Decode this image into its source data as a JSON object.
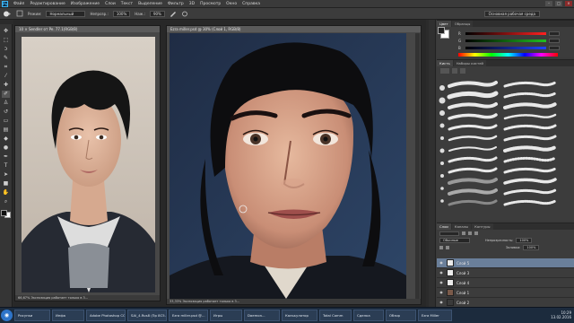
{
  "menubar": {
    "logo": "Ps",
    "items": [
      "Файл",
      "Редактирование",
      "Изображение",
      "Слои",
      "Текст",
      "Выделение",
      "Фильтр",
      "3D",
      "Просмотр",
      "Окно",
      "Справка"
    ],
    "window_buttons": [
      "–",
      "□",
      "×"
    ]
  },
  "options": {
    "mode_label": "Режим:",
    "mode_value": "Нормальный",
    "opacity_label": "Непрозр.:",
    "opacity_value": "100%",
    "flow_label": "Наж.:",
    "flow_value": "90%",
    "workspace": "Основная рабочая среда"
  },
  "tools": {
    "icons": [
      "move",
      "marquee",
      "lasso",
      "quick-select",
      "crop",
      "eyedropper",
      "healing",
      "brush",
      "stamp",
      "history-brush",
      "eraser",
      "gradient",
      "blur",
      "dodge",
      "pen",
      "type",
      "path-select",
      "shape",
      "hand",
      "zoom"
    ]
  },
  "doc1": {
    "title": "10 × Sendler от Pe. 77.1(RGB/8)",
    "status": "66,67%   Экспозиция работает только в 3..."
  },
  "doc2": {
    "title": "Ezra miller.psd @ 30% (Слой 1, RGB/8)",
    "status": "33,33%   Экспозиция работает только в 3..."
  },
  "color_panel": {
    "tabs": [
      "Цвет",
      "Образцы"
    ],
    "slider_labels": [
      "R",
      "G",
      "B"
    ],
    "slider_values": [
      "",
      "",
      ""
    ],
    "colors": {
      "r_track": "#ff2020",
      "g_track": "#20c020",
      "b_track": "#2040ff"
    }
  },
  "brush_panel": {
    "tabs": [
      "Кисть",
      "Наборы кистей"
    ]
  },
  "layers_panel": {
    "tabs": [
      "Слои",
      "Каналы",
      "Контуры"
    ],
    "blend_mode": "Обычные",
    "opacity_label": "Непрозрачность:",
    "opacity_value": "100%",
    "fill_label": "Заливка:",
    "fill_value": "100%",
    "layers": [
      {
        "name": "Слой 5",
        "visible": true,
        "selected": true
      },
      {
        "name": "Слой 3",
        "visible": true,
        "selected": false
      },
      {
        "name": "Слой 4",
        "visible": true,
        "selected": false
      },
      {
        "name": "Слой 1",
        "visible": true,
        "selected": false
      },
      {
        "name": "Слой 2",
        "visible": true,
        "selected": false
      }
    ]
  },
  "taskbar": {
    "start": "◉",
    "tasks": [
      "Рисунки",
      "Инфа",
      "Adobe Photoshop CC",
      "SAI_4.Rus8 (Пр 8C5...)",
      "Ezra miller.psd @...",
      "Игры",
      "Daemon...",
      "Калькулятор",
      "Total Comm",
      "Сделка",
      "Обзор",
      "Ezra Miller"
    ],
    "time": "10:29",
    "date": "13.02.2016"
  }
}
